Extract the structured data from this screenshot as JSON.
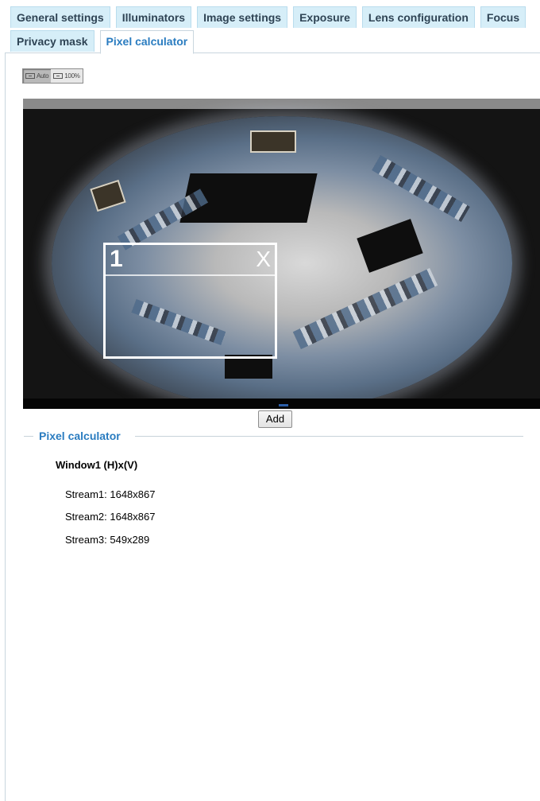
{
  "tabs": {
    "row1": [
      "General settings",
      "Illuminators",
      "Image settings",
      "Exposure",
      "Lens configuration",
      "Focus"
    ],
    "row2": [
      "Privacy mask",
      "Pixel calculator"
    ],
    "active": "Pixel calculator"
  },
  "zoom": {
    "auto_label": "Auto",
    "full_label": "100%"
  },
  "video": {
    "roi_number": "1",
    "roi_close": "X"
  },
  "add_button": "Add",
  "pixel_calculator": {
    "title": "Pixel calculator",
    "window_title": "Window1 (H)x(V)",
    "streams": [
      "Stream1: 1648x867",
      "Stream2: 1648x867",
      "Stream3: 549x289"
    ]
  },
  "colors": {
    "tab_bg": "#d6eef8",
    "accent": "#2a7cc0"
  }
}
